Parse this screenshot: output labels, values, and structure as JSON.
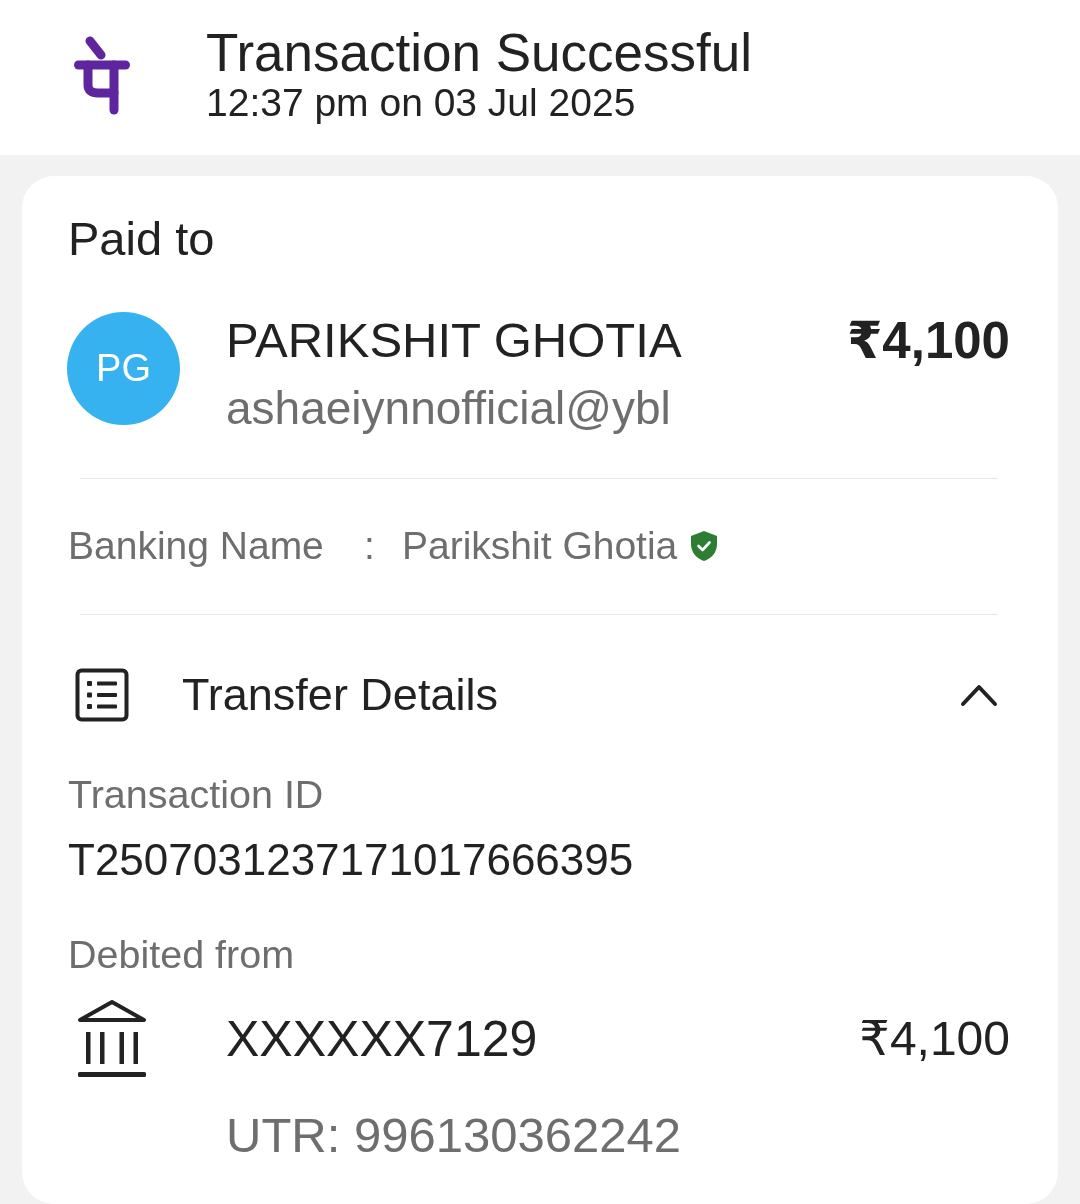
{
  "header": {
    "title": "Transaction Successful",
    "timestamp": "12:37 pm on 03 Jul 2025"
  },
  "paid_to": {
    "heading": "Paid to",
    "avatar_initials": "PG",
    "name": "PARIKSHIT GHOTIA",
    "upi_id": "ashaeiynnofficial@ybl",
    "amount": "₹4,100"
  },
  "banking_name": {
    "label": "Banking Name",
    "separator": ":",
    "value": "Parikshit Ghotia",
    "verified": true
  },
  "transfer_details": {
    "title": "Transfer Details",
    "expanded": true,
    "transaction_id_label": "Transaction ID",
    "transaction_id": "T2507031237171017666395",
    "debited_from_label": "Debited from",
    "account": "XXXXXX7129",
    "amount": "₹4,100",
    "utr": "UTR: 996130362242"
  }
}
